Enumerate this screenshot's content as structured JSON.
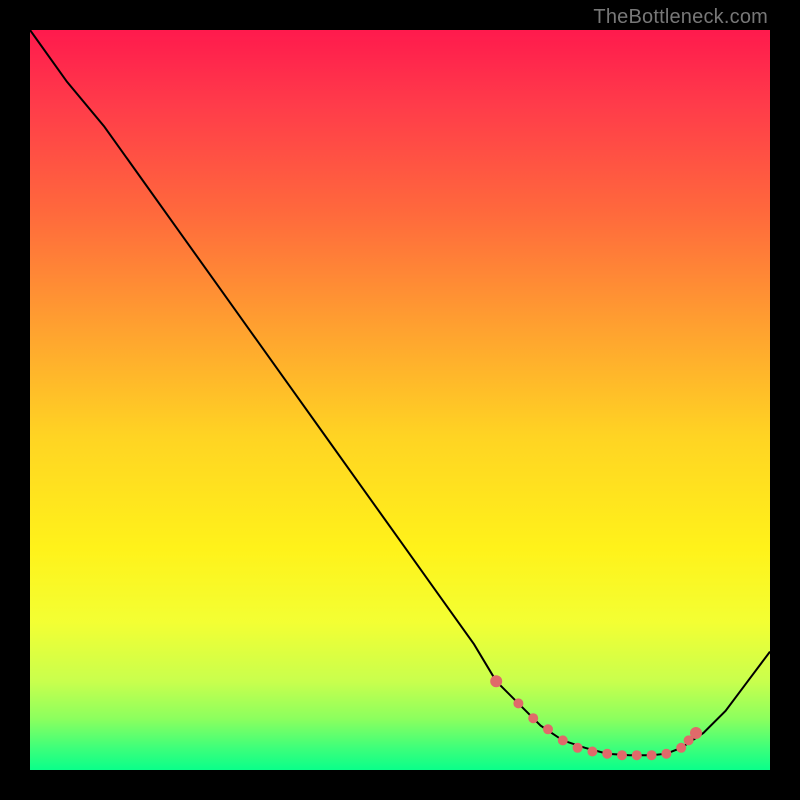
{
  "watermark": "TheBottleneck.com",
  "colors": {
    "page_bg": "#000000",
    "curve": "#000000",
    "dots": "#e06a6a",
    "gradient_top": "#ff1a4d",
    "gradient_mid": "#fff21a",
    "gradient_bottom": "#0aff8a"
  },
  "chart_data": {
    "type": "line",
    "title": "",
    "xlabel": "",
    "ylabel": "",
    "xlim": [
      0,
      100
    ],
    "ylim": [
      0,
      100
    ],
    "grid": false,
    "series": [
      {
        "name": "bottleneck-curve",
        "x": [
          0,
          5,
          10,
          15,
          20,
          25,
          30,
          35,
          40,
          45,
          50,
          55,
          60,
          63,
          66,
          69,
          72,
          75,
          78,
          81,
          84,
          86,
          88,
          91,
          94,
          97,
          100
        ],
        "y": [
          100,
          93,
          87,
          80,
          73,
          66,
          59,
          52,
          45,
          38,
          31,
          24,
          17,
          12,
          9,
          6,
          4,
          3,
          2.2,
          2,
          2,
          2.2,
          3,
          5,
          8,
          12,
          16
        ]
      }
    ],
    "markers": {
      "name": "highlight-dots",
      "x": [
        63,
        66,
        68,
        70,
        72,
        74,
        76,
        78,
        80,
        82,
        84,
        86,
        88,
        89,
        90
      ],
      "y": [
        12,
        9,
        7,
        5.5,
        4,
        3,
        2.5,
        2.2,
        2,
        2,
        2,
        2.2,
        3,
        4,
        5
      ]
    }
  }
}
